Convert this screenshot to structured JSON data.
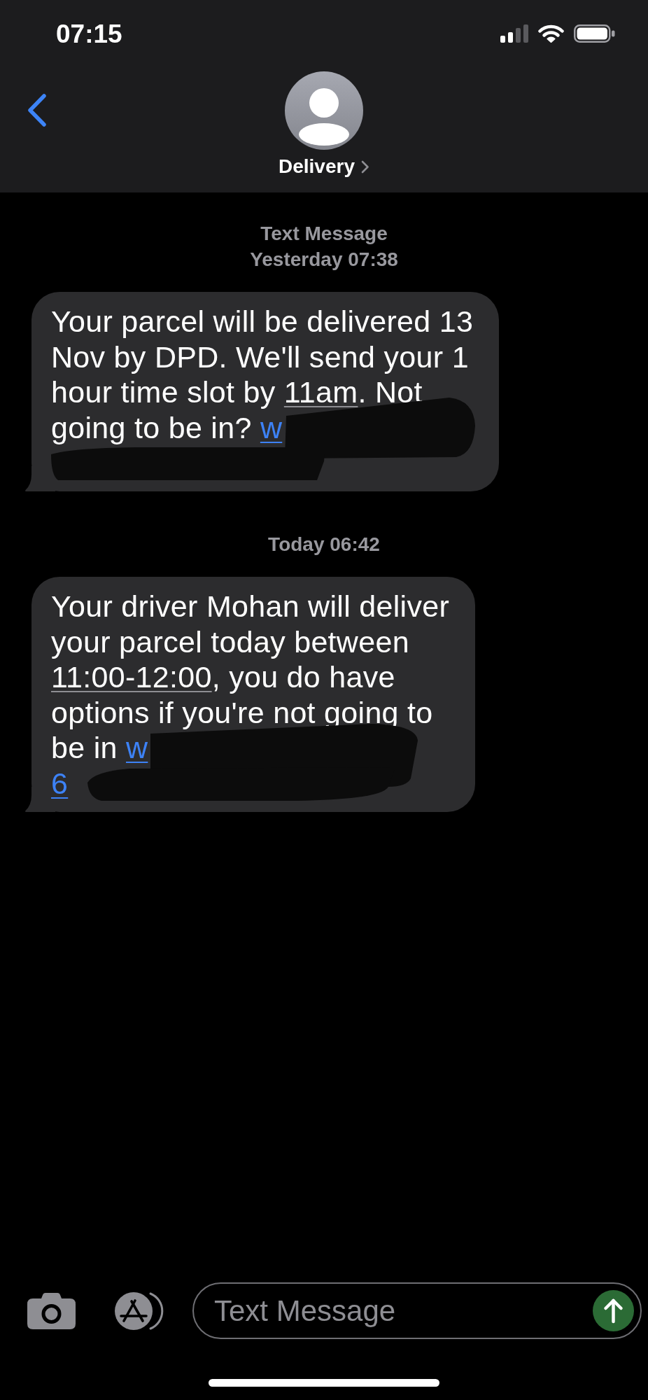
{
  "status_bar": {
    "time": "07:15"
  },
  "header": {
    "contact_name": "Delivery"
  },
  "conversation": [
    {
      "kind": "timestamp",
      "service": "Text Message",
      "time": "Yesterday 07:38"
    },
    {
      "kind": "incoming",
      "redaction": {
        "kind": "full_line"
      },
      "segments": [
        {
          "kind": "plain",
          "text": "Your parcel will be delivered 13\nNov by DPD. We'll send your 1\nhour time slot by "
        },
        {
          "kind": "data",
          "text": "11am"
        },
        {
          "kind": "plain",
          "text": ". Not\ngoing to be in? "
        },
        {
          "kind": "link",
          "text": "w"
        }
      ]
    },
    {
      "kind": "timestamp",
      "time": "Today 06:42"
    },
    {
      "kind": "incoming",
      "redaction": {
        "kind": "partial"
      },
      "segments": [
        {
          "kind": "plain",
          "text": "Your driver Mohan will deliver\nyour parcel today between\n"
        },
        {
          "kind": "data",
          "text": "11:00-12:00"
        },
        {
          "kind": "plain",
          "text": ", you do have\noptions if you're not going to\nbe in "
        },
        {
          "kind": "link",
          "text": "w"
        },
        {
          "kind": "link_next_line",
          "text": "6"
        }
      ]
    }
  ],
  "composer": {
    "placeholder": "Text Message"
  }
}
